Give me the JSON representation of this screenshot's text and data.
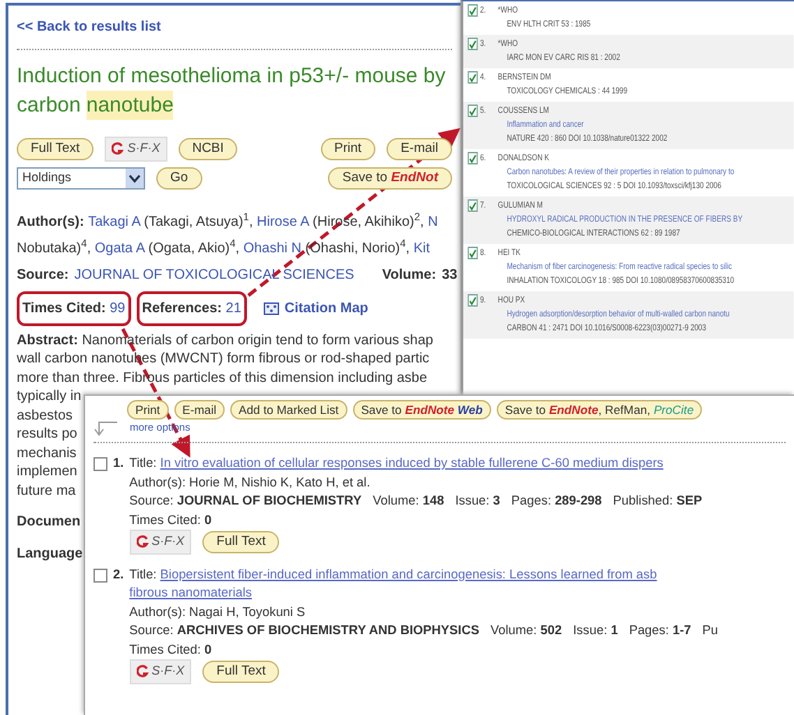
{
  "article": {
    "back_link": "<< Back to results list",
    "title": {
      "line_1": "Induction of mesothelioma in p53+/- mouse by",
      "line_2": "carbon",
      "highlight": "nanotube"
    },
    "buttons": [
      {
        "kind": "button",
        "label": "Full Text"
      },
      {
        "kind": "sfx",
        "label": "S·F·X"
      },
      {
        "kind": "button",
        "label": "NCBI"
      }
    ],
    "print_buttons": [
      "Print",
      "E-mail"
    ],
    "holdings": {
      "value": "Holdings"
    },
    "go_button": "Go",
    "save_button": {
      "prefix": "Save to",
      "brand": "EndNot"
    },
    "authors": {
      "label": "Author(s):",
      "lines": [
        [
          {
            "name": "Takagi A",
            "detail": " (Takagi, Atsuya)",
            "sup": "1",
            "sep": ", "
          },
          {
            "name": "Hirose A",
            "detail": " (Hirose, Akihiko)",
            "sup": "2",
            "sep": ", "
          },
          {
            "name": "N"
          }
        ],
        [
          {
            "detail": "Nobutaka)",
            "sup": "4",
            "sep": ", "
          },
          {
            "name": "Ogata A",
            "detail": " (Ogata, Akio)",
            "sup": "4",
            "sep": ", "
          },
          {
            "name": "Ohashi N",
            "detail": " (Ohashi, Norio)",
            "sup": "4",
            "sep": ", "
          },
          {
            "name": "Kit"
          }
        ]
      ]
    },
    "source": {
      "label": "Source:",
      "journal": "JOURNAL OF TOXICOLOGICAL SCIENCES",
      "volume_label": "Volume:",
      "volume": "33"
    },
    "times_cited": {
      "label": "Times Cited:",
      "value": "99"
    },
    "references": {
      "label": "References:",
      "value": "21"
    },
    "citation_map": "Citation Map",
    "abstract": {
      "label": "Abstract:",
      "lines": [
        "Nanomaterials of carbon origin tend to form various shap",
        "wall carbon nanotubes (MWCNT) form fibrous or rod-shaped partic",
        "more than three. Fibrous particles of this dimension including asbe",
        "typically in",
        "asbestos",
        "results po",
        "mechanis",
        "implemen",
        "future ma"
      ]
    },
    "fields": [
      "Documen",
      "Language"
    ]
  },
  "references_panel": {
    "items": [
      {
        "number": "2.",
        "checked": true,
        "author": "*WHO",
        "source": "ENV HLTH CRIT 53 : 1985"
      },
      {
        "number": "3.",
        "checked": true,
        "author": "*WHO",
        "source": "IARC MON EV CARC RIS 81 : 2002"
      },
      {
        "number": "4.",
        "checked": true,
        "author": "BERNSTEIN DM",
        "source": "TOXICOLOGY CHEMICALS : 44 1999"
      },
      {
        "number": "5.",
        "checked": true,
        "author": "COUSSENS LM",
        "title": "Inflammation and cancer",
        "source": "NATURE 420 : 860 DOI 10.1038/nature01322 2002"
      },
      {
        "number": "6.",
        "checked": true,
        "author": "DONALDSON K",
        "title": "Carbon nanotubes: A review of their properties in relation to pulmonary to",
        "source": "TOXICOLOGICAL SCIENCES 92 : 5 DOI 10.1093/toxsci/kfj130 2006"
      },
      {
        "number": "7.",
        "checked": true,
        "author": "GULUMIAN M",
        "title": "HYDROXYL RADICAL PRODUCTION IN THE PRESENCE OF FIBERS BY",
        "source": "CHEMICO-BIOLOGICAL INTERACTIONS 62 : 89 1987"
      },
      {
        "number": "8.",
        "checked": true,
        "author": "HEI TK",
        "title": "Mechanism of fiber carcinogenesis: From reactive radical species to silic",
        "source": "INHALATION TOXICOLOGY 18 : 985 DOI 10.1080/08958370600835310"
      },
      {
        "number": "9.",
        "checked": true,
        "author": "HOU PX",
        "title": "Hydrogen adsorption/desorption behavior of multi-walled carbon nanotu",
        "source": "CARBON 41 : 2471 DOI 10.1016/S0008-6223(03)00271-9 2003"
      }
    ]
  },
  "citing_panel": {
    "toolbar": [
      [
        {
          "kind": "plain",
          "text": "Print"
        }
      ],
      [
        {
          "kind": "plain",
          "text": "E-mail"
        }
      ],
      [
        {
          "kind": "plain",
          "text": "Add to Marked List"
        }
      ],
      [
        {
          "kind": "plain",
          "text": "Save to "
        },
        {
          "kind": "brand",
          "text": "EndNote"
        },
        {
          "kind": "web",
          "text": " Web"
        }
      ],
      [
        {
          "kind": "plain",
          "text": "Save to "
        },
        {
          "kind": "brand",
          "text": "EndNote"
        },
        {
          "kind": "dark",
          "text": ", RefMan, "
        },
        {
          "kind": "teal",
          "text": "ProCite"
        }
      ]
    ],
    "more_options": "more options",
    "records": [
      {
        "checked": false,
        "number": "1.",
        "title_label": "Title:",
        "title_lines": [
          "In vitro evaluation of cellular responses induced by stable fullerene C-60 medium dispers"
        ],
        "authors": "Author(s): Horie M, Nishio K, Kato H, et al.",
        "source": [
          {
            "label": "Source:",
            "value": "JOURNAL OF BIOCHEMISTRY"
          },
          {
            "label": "Volume:",
            "value": "148"
          },
          {
            "label": "Issue:",
            "value": "3"
          },
          {
            "label": "Pages:",
            "value": "289-298"
          },
          {
            "label": "Published:",
            "value": "SEP"
          }
        ],
        "times_cited": {
          "label": "Times Cited:",
          "value": "0"
        },
        "sfx": "S·F·X",
        "full_text": "Full Text"
      },
      {
        "checked": false,
        "number": "2.",
        "title_label": "Title:",
        "title_lines": [
          "Biopersistent fiber-induced inflammation and carcinogenesis: Lessons learned from asb",
          "fibrous nanomaterials"
        ],
        "authors": "Author(s): Nagai H, Toyokuni S",
        "source": [
          {
            "label": "Source:",
            "value": "ARCHIVES OF BIOCHEMISTRY AND BIOPHYSICS"
          },
          {
            "label": "Volume:",
            "value": "502"
          },
          {
            "label": "Issue:",
            "value": "1"
          },
          {
            "label": "Pages:",
            "value": "1-7"
          },
          {
            "label": "Pu"
          }
        ],
        "times_cited": {
          "label": "Times Cited:",
          "value": "0"
        },
        "sfx": "S·F·X",
        "full_text": "Full Text"
      }
    ]
  }
}
